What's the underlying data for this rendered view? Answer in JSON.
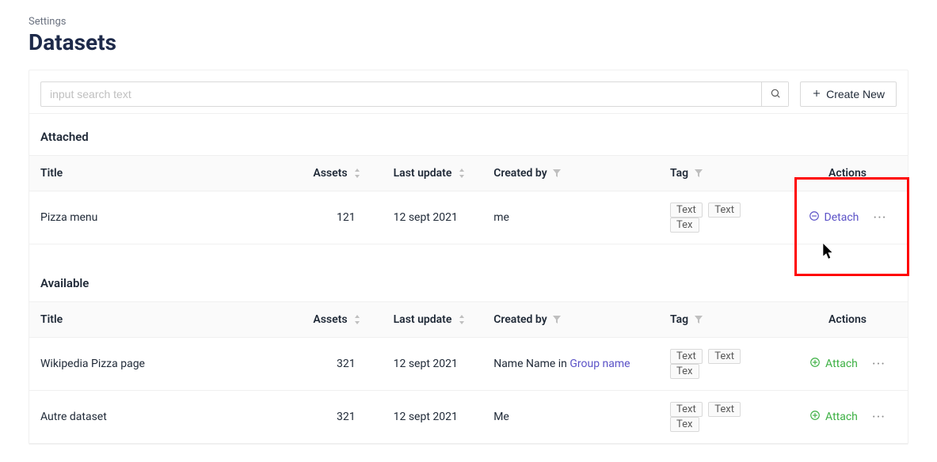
{
  "breadcrumb": "Settings",
  "page_title": "Datasets",
  "search": {
    "placeholder": "input search text"
  },
  "create_button": "Create New",
  "sections": {
    "attached": {
      "label": "Attached",
      "columns": {
        "title": "Title",
        "assets": "Assets",
        "updated": "Last update",
        "createdby": "Created by",
        "tag": "Tag",
        "actions": "Actions"
      },
      "rows": [
        {
          "title": "Pizza menu",
          "assets": "121",
          "updated": "12 sept 2021",
          "createdby": "me",
          "tags": [
            "Text",
            "Text",
            "Tex"
          ],
          "action_label": "Detach"
        }
      ]
    },
    "available": {
      "label": "Available",
      "columns": {
        "title": "Title",
        "assets": "Assets",
        "updated": "Last update",
        "createdby": "Created by",
        "tag": "Tag",
        "actions": "Actions"
      },
      "rows": [
        {
          "title": "Wikipedia Pizza page",
          "assets": "321",
          "updated": "12 sept 2021",
          "createdby_prefix": "Name Name in ",
          "createdby_group": "Group name",
          "tags": [
            "Text",
            "Text",
            "Tex"
          ],
          "action_label": "Attach"
        },
        {
          "title": "Autre dataset",
          "assets": "321",
          "updated": "12 sept 2021",
          "createdby": "Me",
          "tags": [
            "Text",
            "Text",
            "Tex"
          ],
          "action_label": "Attach"
        }
      ]
    }
  }
}
